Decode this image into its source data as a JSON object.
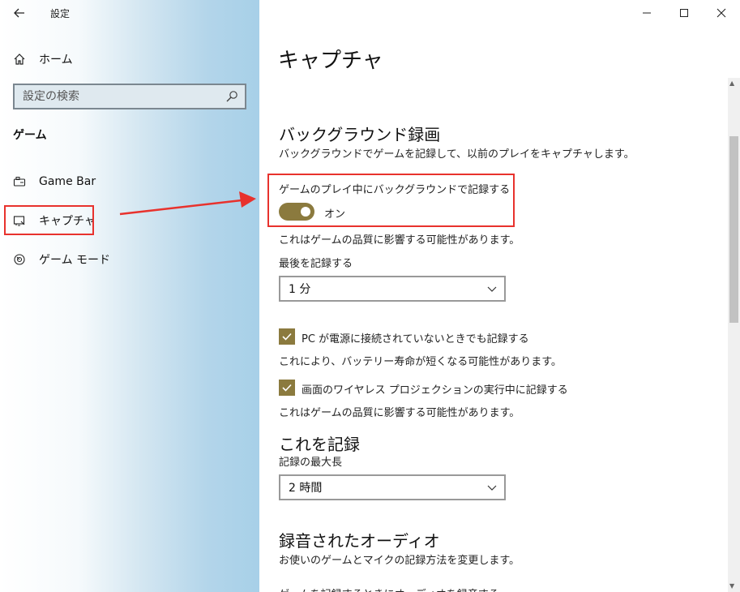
{
  "window": {
    "title": "設定",
    "controls": {
      "minimize": "—",
      "maximize": "☐",
      "close": "✕"
    }
  },
  "sidebar": {
    "home_label": "ホーム",
    "search_placeholder": "設定の検索",
    "section_title": "ゲーム",
    "items": [
      {
        "label": "Game Bar",
        "icon": "game-bar-icon"
      },
      {
        "label": "キャプチャ",
        "icon": "capture-icon",
        "selected": true
      },
      {
        "label": "ゲーム モード",
        "icon": "game-mode-icon"
      }
    ]
  },
  "main": {
    "title": "キャプチャ",
    "background": {
      "heading": "バックグラウンド録画",
      "description": "バックグラウンドでゲームを記録して、以前のプレイをキャプチャします。",
      "toggle_label": "ゲームのプレイ中にバックグラウンドで記録する",
      "toggle_state": "オン",
      "toggle_on": true,
      "quality_note": "これはゲームの品質に影響する可能性があります。",
      "record_last_label": "最後を記録する",
      "record_last_value": "1 分",
      "checkbox1_label": "PC が電源に接続されていないときでも記録する",
      "checkbox1_checked": true,
      "checkbox1_note": "これにより、バッテリー寿命が短くなる可能性があります。",
      "checkbox2_label": "画面のワイヤレス プロジェクションの実行中に記録する",
      "checkbox2_checked": true,
      "checkbox2_note": "これはゲームの品質に影響する可能性があります。"
    },
    "record_this": {
      "heading": "これを記録",
      "max_length_label": "記録の最大長",
      "max_length_value": "2 時間"
    },
    "audio": {
      "heading": "録音されたオーディオ",
      "description": "お使いのゲームとマイクの記録方法を変更します。",
      "cut_text": "ゲームを記録するときにオーディオを録音する"
    }
  },
  "colors": {
    "accent": "#8b7a3e",
    "highlight": "#e8322d",
    "arrow": "#e8322d"
  }
}
